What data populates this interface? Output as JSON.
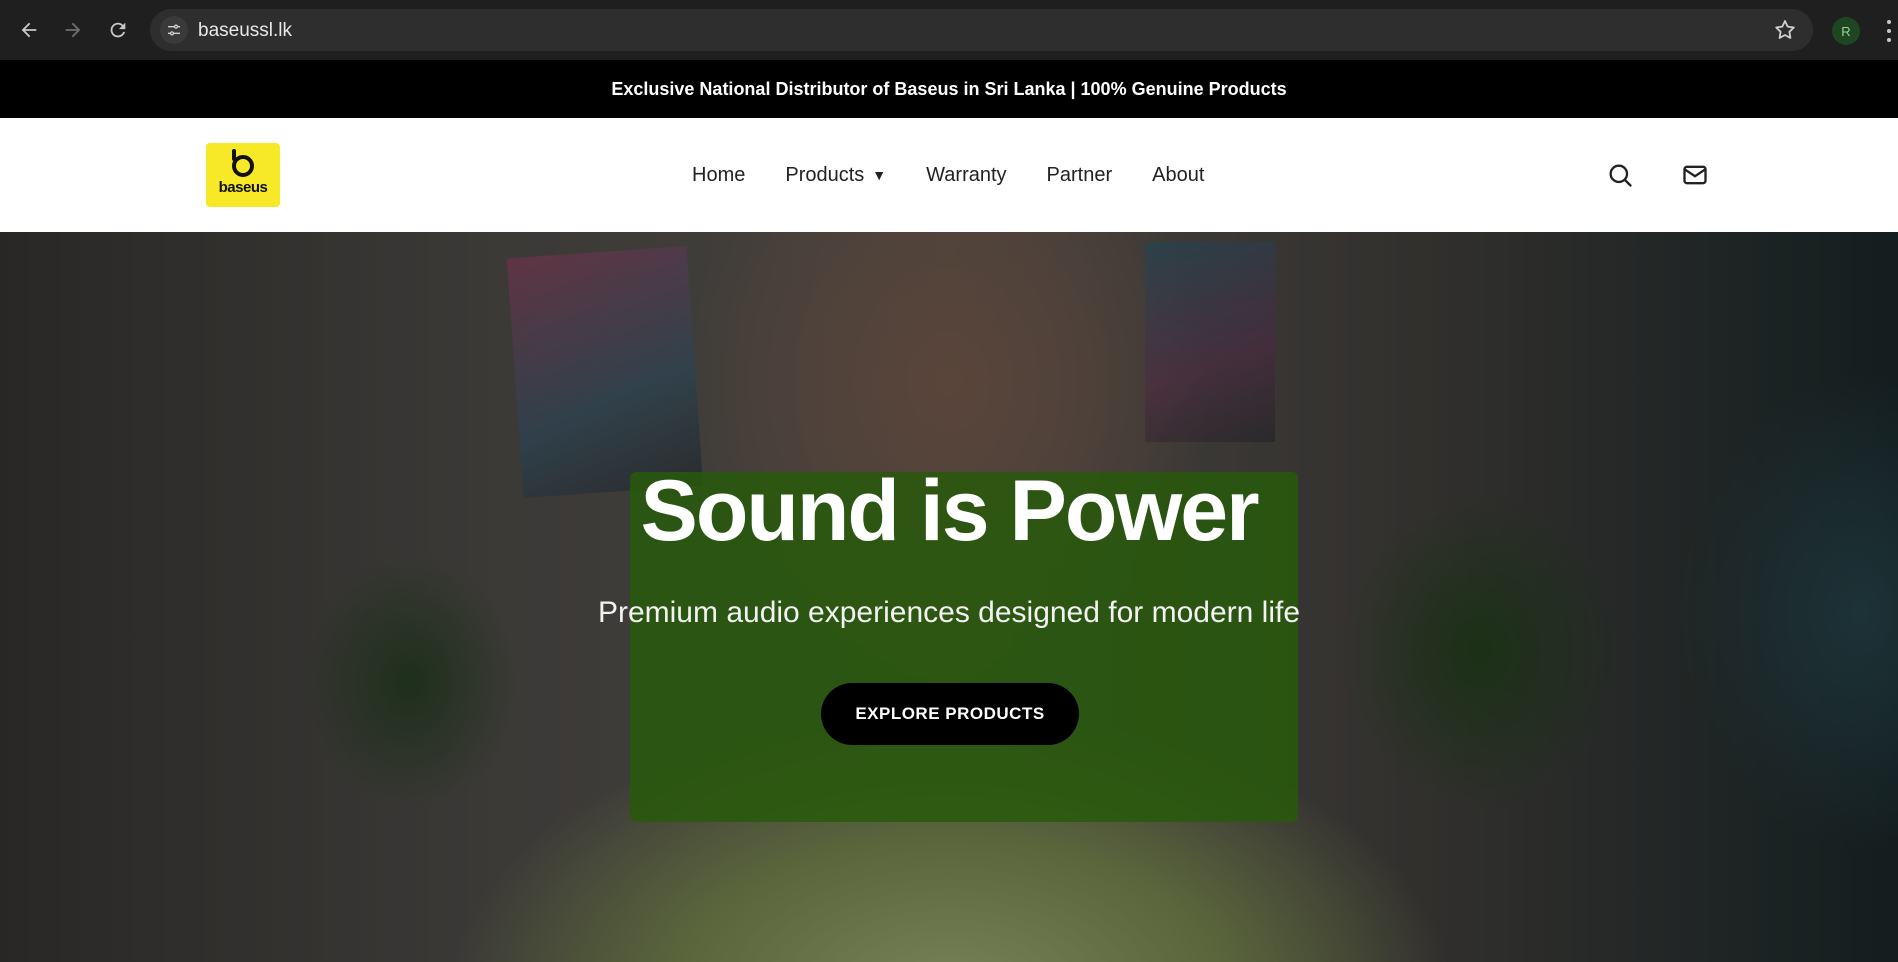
{
  "browser": {
    "url": "baseussl.lk",
    "profile_initial": "R",
    "icons": [
      "back-icon",
      "forward-icon",
      "reload-icon",
      "site-settings-icon",
      "bookmark-star-icon",
      "kebab-menu-icon"
    ]
  },
  "announcement": {
    "text": "Exclusive National Distributor of Baseus in Sri Lanka | 100% Genuine Products"
  },
  "header": {
    "logo_text": "baseus",
    "nav": [
      {
        "label": "Home"
      },
      {
        "label": "Products",
        "has_dropdown": true,
        "caret": "▼"
      },
      {
        "label": "Warranty"
      },
      {
        "label": "Partner"
      },
      {
        "label": "About"
      }
    ],
    "icons": [
      "search-icon",
      "mail-icon"
    ]
  },
  "hero": {
    "title": "Sound is Power",
    "subtitle": "Premium audio experiences designed for modern life",
    "cta_label": "EXPLORE PRODUCTS"
  },
  "colors": {
    "announce_bg": "#000000",
    "logo_bg": "#f7e928",
    "cta_bg": "#000000",
    "chrome_bg": "#1f1f1f"
  }
}
